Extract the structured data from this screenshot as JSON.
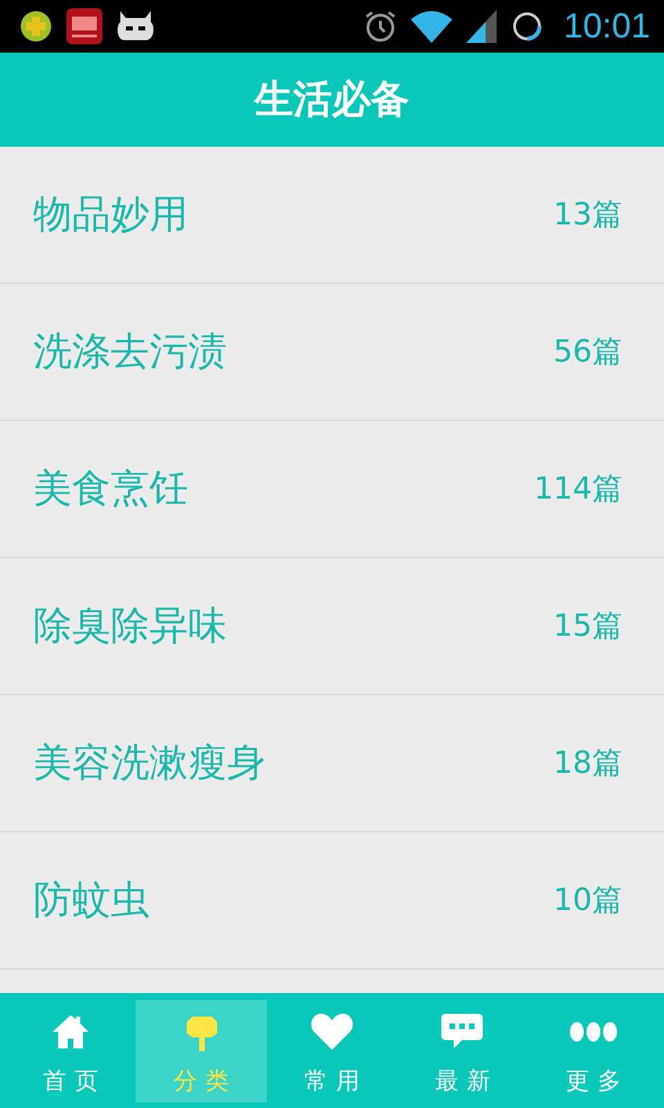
{
  "status_bar": {
    "time": "10:01"
  },
  "header": {
    "title": "生活必备"
  },
  "categories": [
    {
      "name": "物品妙用",
      "count": "13篇"
    },
    {
      "name": "洗涤去污渍",
      "count": "56篇"
    },
    {
      "name": "美食烹饪",
      "count": "114篇"
    },
    {
      "name": "除臭除异味",
      "count": "15篇"
    },
    {
      "name": "美容洗漱瘦身",
      "count": "18篇"
    },
    {
      "name": "防蚊虫",
      "count": "10篇"
    }
  ],
  "tabs": [
    {
      "label": "首页",
      "kind": "home",
      "selected": false
    },
    {
      "label": "分类",
      "kind": "tree",
      "selected": true
    },
    {
      "label": "常用",
      "kind": "heart",
      "selected": false
    },
    {
      "label": "最新",
      "kind": "chat",
      "selected": false
    },
    {
      "label": "更多",
      "kind": "dots",
      "selected": false
    }
  ]
}
